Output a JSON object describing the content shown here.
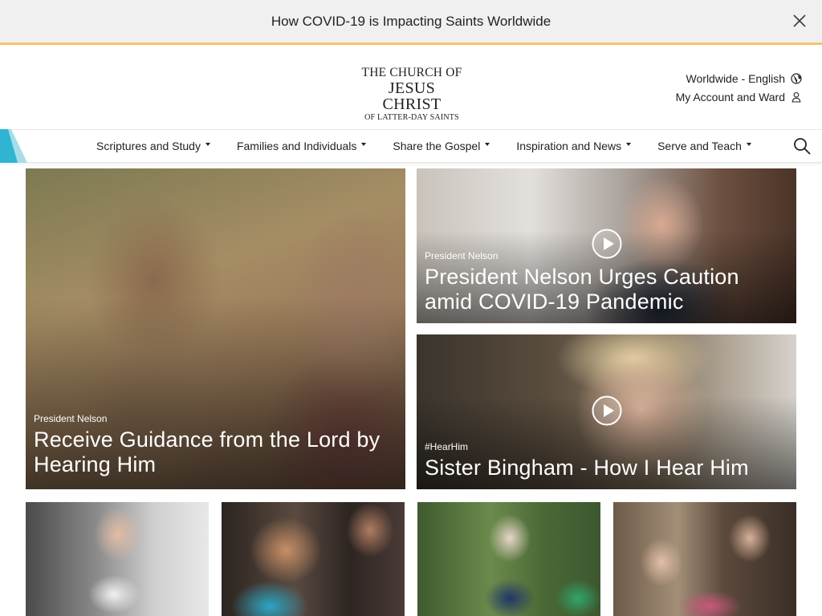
{
  "alert": {
    "text": "How COVID-19 is Impacting Saints Worldwide",
    "close_icon": "close-icon",
    "border_color": "#f5c26b",
    "background": "#f0f0f0"
  },
  "header": {
    "logo": {
      "line1": "THE CHURCH OF",
      "line2": "JESUS CHRIST",
      "line3": "OF LATTER-DAY SAINTS"
    },
    "language_link": "Worldwide - English",
    "language_icon": "globe-icon",
    "account_link": "My Account and Ward",
    "account_icon": "user-icon"
  },
  "nav": {
    "items": [
      {
        "label": "Scriptures and Study"
      },
      {
        "label": "Families and Individuals"
      },
      {
        "label": "Share the Gospel"
      },
      {
        "label": "Inspiration and News"
      },
      {
        "label": "Serve and Teach"
      }
    ],
    "search_icon": "search-icon",
    "accent_colors": [
      "#2fb5d2",
      "#a7dde9"
    ]
  },
  "features": {
    "large": {
      "kicker": "President Nelson",
      "title": "Receive Guidance from the Lord by Hearing Him"
    },
    "video1": {
      "kicker": "President Nelson",
      "title": "President Nelson Urges Caution amid COVID-19 Pandemic",
      "icon": "play-icon"
    },
    "video2": {
      "kicker": "#HearHim",
      "title": "Sister Bingham - How I Hear Him",
      "icon": "play-icon"
    }
  }
}
